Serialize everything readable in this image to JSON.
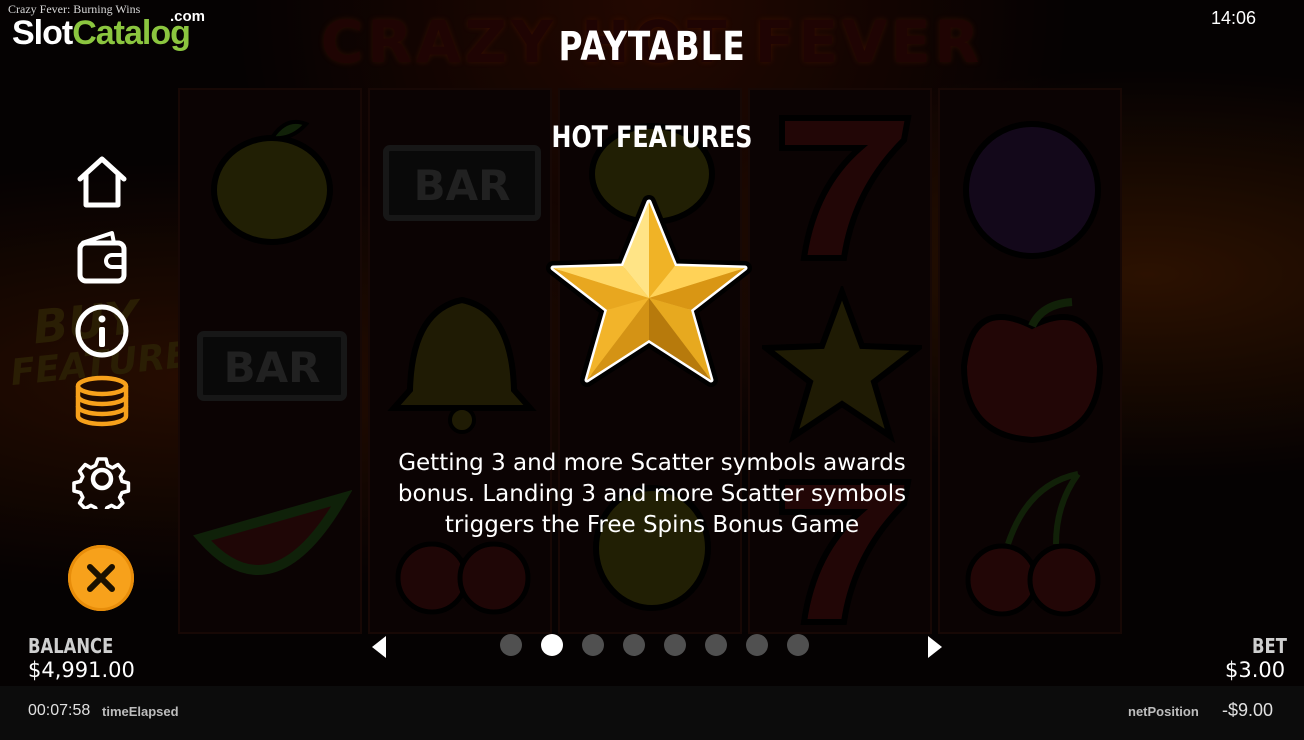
{
  "header": {
    "game_name": "Crazy Fever: Burning Wins",
    "watermark_slot": "Slot",
    "watermark_catalog": "Catalog",
    "watermark_domain": ".com",
    "clock": "14:06",
    "background_logo": "CRAZY HOT FEVER"
  },
  "side_promo": {
    "line1": "BUY",
    "line2": "FEATURE"
  },
  "reels": {
    "bar_label": "BAR",
    "symbols": [
      [
        "lemon",
        "bar",
        "watermelon"
      ],
      [
        "bar",
        "bell",
        "cherries"
      ],
      [
        "lemon",
        "star",
        "lemon"
      ],
      [
        "seven",
        "star",
        "seven"
      ],
      [
        "plum",
        "apple",
        "cherries"
      ]
    ]
  },
  "paytable": {
    "title": "PAYTABLE",
    "subtitle": "HOT FEATURES",
    "symbol": "star-icon",
    "description": "Getting 3 and more Scatter symbols awards bonus. Landing 3 and more Scatter symbols triggers the Free Spins Bonus Game",
    "total_pages": 8,
    "current_page": 2
  },
  "menu": {
    "items": [
      "home-icon",
      "wallet-icon",
      "info-icon",
      "coins-icon",
      "gear-icon"
    ],
    "active": "coins-icon",
    "close": "close-icon"
  },
  "status": {
    "balance_label": "BALANCE",
    "balance_value": "$4,991.00",
    "bet_label": "BET",
    "bet_value": "$3.00"
  },
  "footer": {
    "time_elapsed_value": "00:07:58",
    "time_elapsed_label": "timeElapsed",
    "net_position_label": "netPosition",
    "net_position_value": "-$9.00"
  },
  "colors": {
    "accent_orange": "#f7a11b",
    "watermark_green": "#8bc53f",
    "star_gold": "#f2b92a",
    "dot_inactive": "#505050",
    "dot_active": "#ffffff"
  }
}
